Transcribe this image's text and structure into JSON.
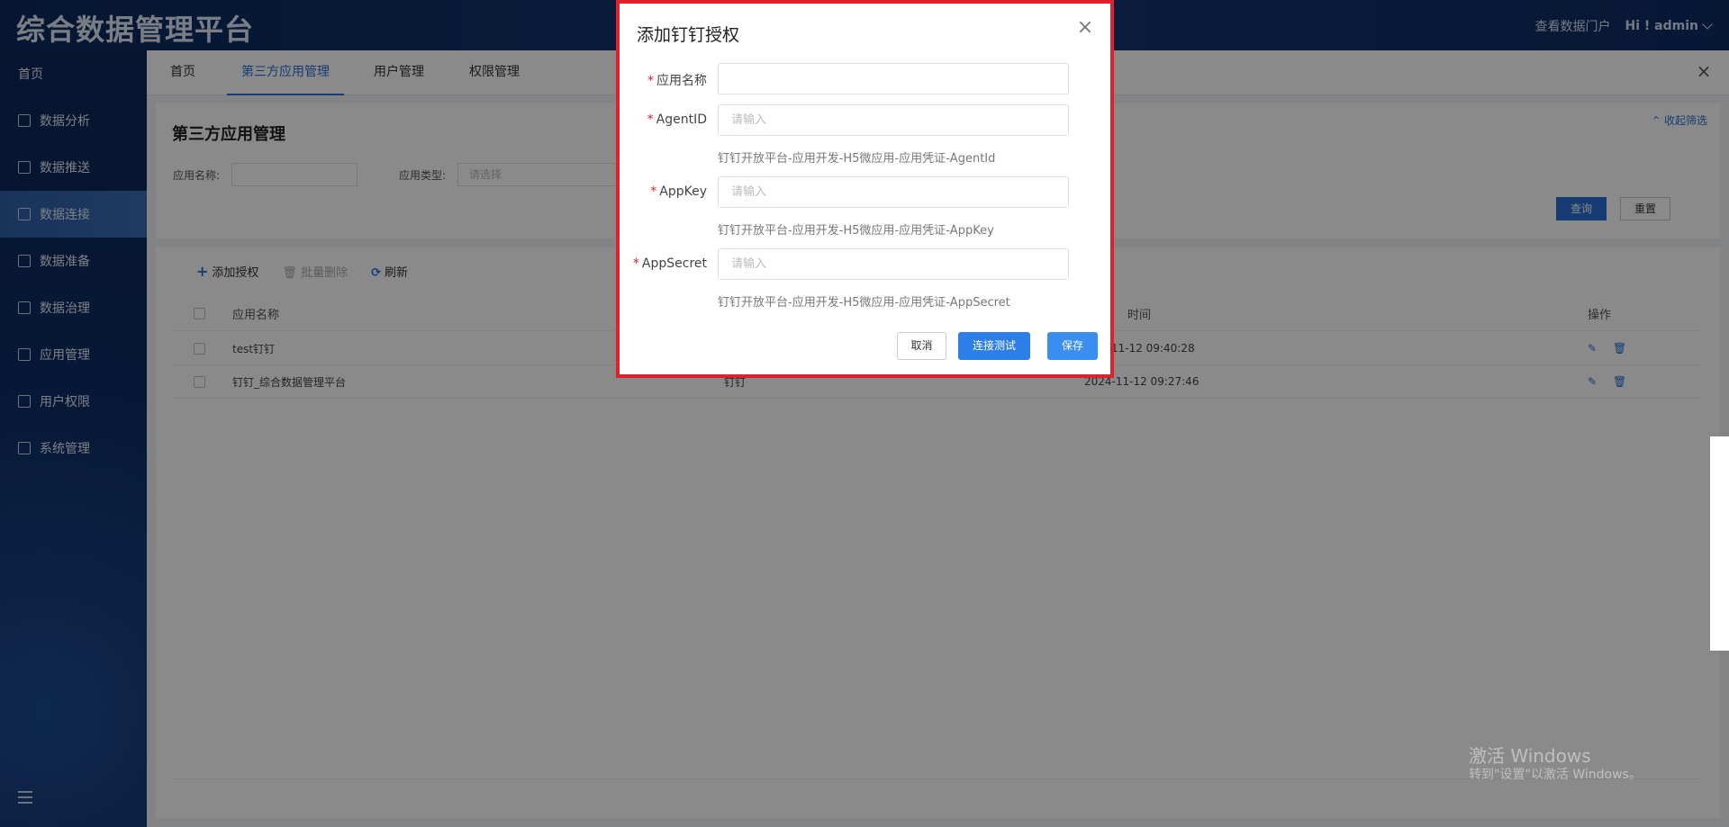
{
  "header": {
    "logo": "综合数据管理平台",
    "portal_link": "查看数据门户",
    "user": "Hi ! admin"
  },
  "sidebar": {
    "home": "首页",
    "items": [
      {
        "label": "数据分析",
        "icon": "chart-icon"
      },
      {
        "label": "数据推送",
        "icon": "push-icon"
      },
      {
        "label": "数据连接",
        "icon": "connect-icon"
      },
      {
        "label": "数据准备",
        "icon": "prepare-icon"
      },
      {
        "label": "数据治理",
        "icon": "layers-icon"
      },
      {
        "label": "应用管理",
        "icon": "apps-icon"
      },
      {
        "label": "用户权限",
        "icon": "user-permission-icon"
      },
      {
        "label": "系统管理",
        "icon": "system-icon"
      }
    ],
    "active_index": 2
  },
  "tabs": [
    {
      "label": "首页"
    },
    {
      "label": "第三方应用管理"
    },
    {
      "label": "用户管理"
    },
    {
      "label": "权限管理"
    }
  ],
  "filter": {
    "title": "第三方应用管理",
    "collapse": "收起筛选",
    "app_name_label": "应用名称:",
    "app_type_label": "应用类型:",
    "app_type_placeholder": "请选择",
    "query": "查询",
    "reset": "重置"
  },
  "list": {
    "add": "添加授权",
    "batch_delete": "批量删除",
    "refresh": "刷新",
    "columns": {
      "name": "应用名称",
      "time": "时间",
      "op": "操作"
    },
    "rows": [
      {
        "name": "test钉钉",
        "type": "",
        "time": "11-12 09:40:28"
      },
      {
        "name": "钉钉_综合数据管理平台",
        "type": "钉钉",
        "time": "2024-11-12 09:27:46"
      }
    ]
  },
  "modal": {
    "title": "添加钉钉授权",
    "fields": [
      {
        "label": "应用名称",
        "placeholder": "",
        "hint": ""
      },
      {
        "label": "AgentID",
        "placeholder": "请输入",
        "hint": "钉钉开放平台-应用开发-H5微应用-应用凭证-AgentId"
      },
      {
        "label": "AppKey",
        "placeholder": "请输入",
        "hint": "钉钉开放平台-应用开发-H5微应用-应用凭证-AppKey"
      },
      {
        "label": "AppSecret",
        "placeholder": "请输入",
        "hint": "钉钉开放平台-应用开发-H5微应用-应用凭证-AppSecret"
      }
    ],
    "cancel": "取消",
    "test": "连接测试",
    "save": "保存"
  },
  "watermark": {
    "line1": "激活 Windows",
    "line2": "转到\"设置\"以激活 Windows。"
  },
  "colors": {
    "primary": "#2b6fd6",
    "modal_border": "#e0202a",
    "header_bg": "#0c2a5c"
  }
}
